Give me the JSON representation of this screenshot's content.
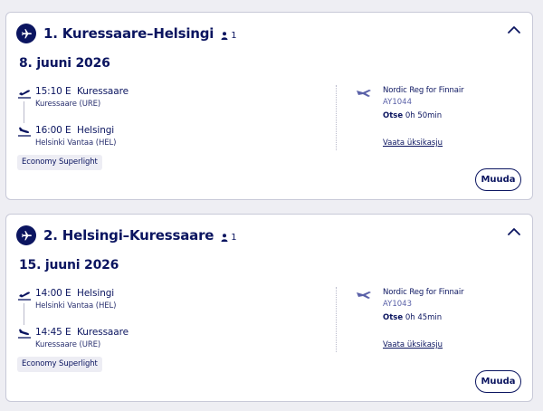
{
  "colors": {
    "brand_navy": "#0b1560",
    "border": "#c8c9d8",
    "badge_bg": "#ededf4",
    "flight_no": "#5a61a8"
  },
  "icons": {
    "section_icon": "plane-icon",
    "passenger_icon": "person-icon",
    "collapse_icon": "chevron-up-icon",
    "departure_icon": "plane-takeoff-icon",
    "arrival_icon": "plane-landing-icon",
    "airline_icon": "finnair-logo-icon"
  },
  "flights": [
    {
      "title": "1. Kuressaare–Helsingi",
      "passengers": "1",
      "date": "8. juuni 2026",
      "departure": {
        "time": "15:10 E",
        "city": "Kuressaare",
        "airport": "Kuressaare (URE)"
      },
      "arrival": {
        "time": "16:00 E",
        "city": "Helsingi",
        "airport": "Helsinki Vantaa (HEL)"
      },
      "fare": "Economy Superlight",
      "operator": "Nordic Reg for Finnair",
      "flight_number": "AY1044",
      "duration_label": "Otse",
      "duration": "0h 50min",
      "details_link": "Vaata üksikasju",
      "change_button": "Muuda"
    },
    {
      "title": "2. Helsingi–Kuressaare",
      "passengers": "1",
      "date": "15. juuni 2026",
      "departure": {
        "time": "14:00 E",
        "city": "Helsingi",
        "airport": "Helsinki Vantaa (HEL)"
      },
      "arrival": {
        "time": "14:45 E",
        "city": "Kuressaare",
        "airport": "Kuressaare (URE)"
      },
      "fare": "Economy Superlight",
      "operator": "Nordic Reg for Finnair",
      "flight_number": "AY1043",
      "duration_label": "Otse",
      "duration": "0h 45min",
      "details_link": "Vaata üksikasju",
      "change_button": "Muuda"
    }
  ]
}
